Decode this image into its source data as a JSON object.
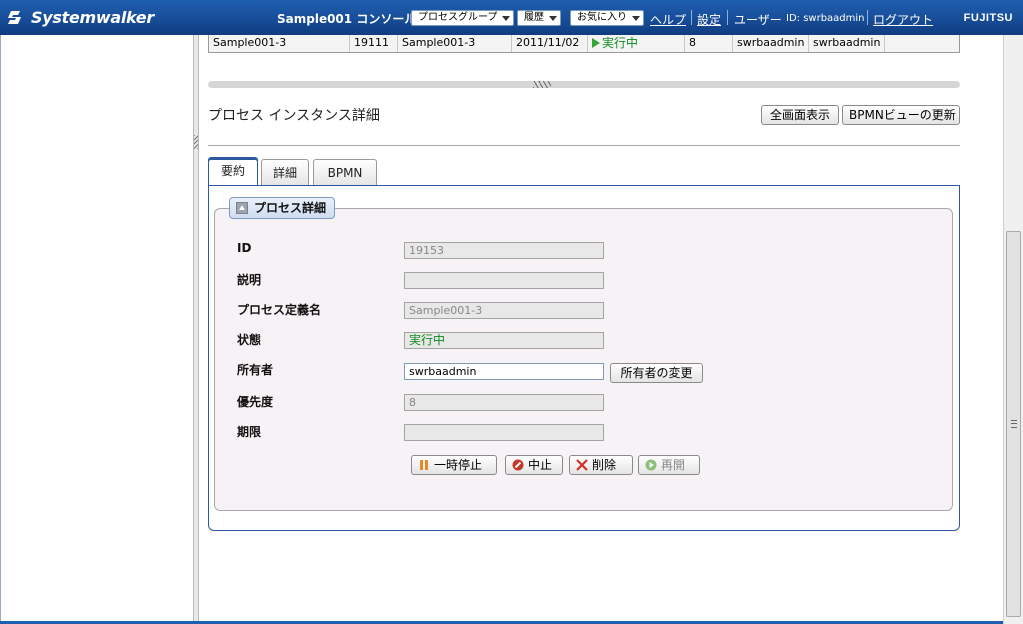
{
  "header": {
    "logo_text": "Systemwalker",
    "console_title": "Sample001 コンソール",
    "menus": [
      "プロセスグループ",
      "履歴",
      "お気に入り"
    ],
    "help_link": "ヘルプ",
    "settings_link": "設定",
    "user_label": "ユーザー",
    "user_id": "ID: swrbaadmin",
    "logout_link": "ログアウト",
    "brand": "FUJITSU"
  },
  "instance_row": {
    "cells": [
      "Sample001-3",
      "19111",
      "Sample001-3",
      "2011/11/02",
      "実行中",
      "8",
      "swrbaadmin",
      "swrbaadmin",
      ""
    ]
  },
  "section": {
    "title": "プロセス インスタンス詳細",
    "fullscreen_button": "全画面表示",
    "bpmn_refresh_button": "BPMNビューの更新"
  },
  "tabs": [
    {
      "label": "要約",
      "active": true
    },
    {
      "label": "詳細",
      "active": false
    },
    {
      "label": "BPMN",
      "active": false
    }
  ],
  "details": {
    "legend": "プロセス詳細",
    "fields": [
      {
        "label": "ID",
        "value": "19153"
      },
      {
        "label": "説明",
        "value": ""
      },
      {
        "label": "プロセス定義名",
        "value": "Sample001-3"
      },
      {
        "label": "状態",
        "value": "実行中"
      },
      {
        "label": "所有者",
        "value": "swrbaadmin"
      },
      {
        "label": "優先度",
        "value": "8"
      },
      {
        "label": "期限",
        "value": ""
      }
    ],
    "change_owner_button": "所有者の変更"
  },
  "actions": {
    "suspend": "一時停止",
    "abort": "中止",
    "delete": "削除",
    "resume": "再開"
  },
  "colors": {
    "header_blue": "#174d98",
    "running_green": "#0c8a1c",
    "abort_red": "#c0392b",
    "tab_border": "#2d57a0"
  }
}
